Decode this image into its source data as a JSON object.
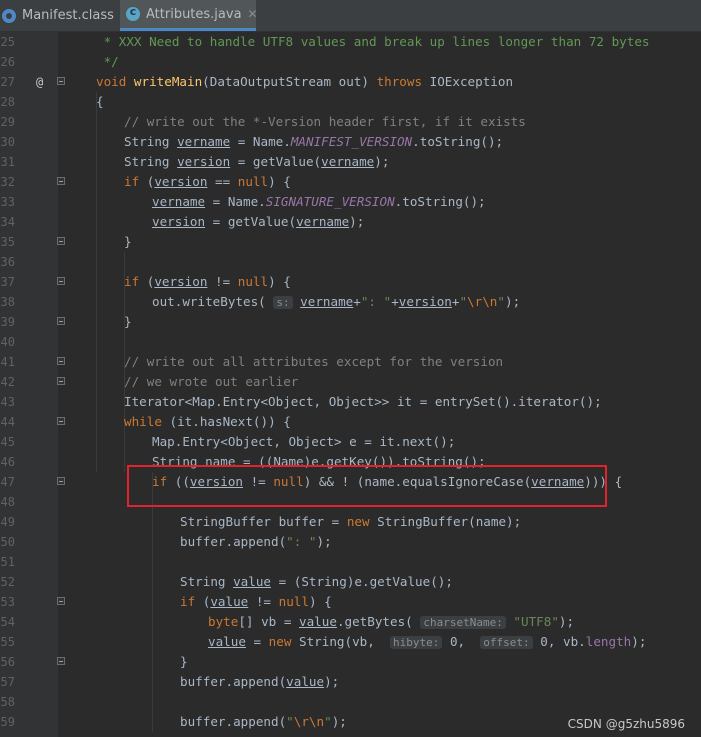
{
  "tabs": [
    {
      "label": "Manifest.class",
      "icon": "class-file-icon",
      "active": false
    },
    {
      "label": "Attributes.java",
      "icon": "java-class-icon",
      "active": true
    }
  ],
  "lines": [
    {
      "n": "25",
      "indent": 1,
      "tokens": [
        [
          "cm",
          " * XXX Need to handle UTF8 values and break up lines longer than 72 bytes"
        ]
      ]
    },
    {
      "n": "26",
      "indent": 1,
      "tokens": [
        [
          "cm",
          " */"
        ]
      ]
    },
    {
      "n": "27",
      "indent": 1,
      "mark": "@",
      "fold": true,
      "tokens": [
        [
          "kw",
          "void "
        ],
        [
          "fn",
          "writeMain"
        ],
        [
          "",
          "(DataOutputStream out) "
        ],
        [
          "kw",
          "throws "
        ],
        [
          "",
          "IOException"
        ]
      ]
    },
    {
      "n": "28",
      "indent": 1,
      "tokens": [
        [
          "",
          "{"
        ]
      ]
    },
    {
      "n": "29",
      "indent": 2,
      "tokens": [
        [
          "lc",
          "// write out the *-Version header first, if it exists"
        ]
      ]
    },
    {
      "n": "30",
      "indent": 2,
      "tokens": [
        [
          "",
          "String "
        ],
        [
          "ul",
          "vername"
        ],
        [
          "",
          " = Name."
        ],
        [
          "fld",
          "MANIFEST_VERSION"
        ],
        [
          "",
          ".toString();"
        ]
      ]
    },
    {
      "n": "31",
      "indent": 2,
      "tokens": [
        [
          "",
          "String "
        ],
        [
          "ul",
          "version"
        ],
        [
          "",
          " = getValue("
        ],
        [
          "ul",
          "vername"
        ],
        [
          "",
          ");"
        ]
      ]
    },
    {
      "n": "32",
      "indent": 2,
      "fold": true,
      "tokens": [
        [
          "kw",
          "if "
        ],
        [
          "",
          "("
        ],
        [
          "ul",
          "version"
        ],
        [
          "",
          " == "
        ],
        [
          "kw",
          "null"
        ],
        [
          "",
          ") {"
        ]
      ]
    },
    {
      "n": "33",
      "indent": 3,
      "tokens": [
        [
          "ul",
          "vername"
        ],
        [
          "",
          " = Name."
        ],
        [
          "fld",
          "SIGNATURE_VERSION"
        ],
        [
          "",
          ".toString();"
        ]
      ]
    },
    {
      "n": "34",
      "indent": 3,
      "tokens": [
        [
          "ul",
          "version"
        ],
        [
          "",
          " = getValue("
        ],
        [
          "ul",
          "vername"
        ],
        [
          "",
          ");"
        ]
      ]
    },
    {
      "n": "35",
      "indent": 2,
      "fold": true,
      "tokens": [
        [
          "",
          "}"
        ]
      ]
    },
    {
      "n": "36",
      "indent": 2,
      "tokens": []
    },
    {
      "n": "37",
      "indent": 2,
      "fold": true,
      "tokens": [
        [
          "kw",
          "if "
        ],
        [
          "",
          "("
        ],
        [
          "ul",
          "version"
        ],
        [
          "",
          " != "
        ],
        [
          "kw",
          "null"
        ],
        [
          "",
          ") {"
        ]
      ]
    },
    {
      "n": "38",
      "indent": 3,
      "tokens": [
        [
          "",
          "out.writeBytes( "
        ],
        [
          "hint",
          "s:"
        ],
        [
          "",
          " "
        ],
        [
          "ul",
          "vername"
        ],
        [
          "",
          "+"
        ],
        [
          "st",
          "\": \""
        ],
        [
          "",
          "+"
        ],
        [
          "ul",
          "version"
        ],
        [
          "",
          "+"
        ],
        [
          "st",
          "\""
        ],
        [
          "esc",
          "\\r\\n"
        ],
        [
          "st",
          "\""
        ],
        [
          "",
          ");"
        ]
      ]
    },
    {
      "n": "39",
      "indent": 2,
      "fold": true,
      "tokens": [
        [
          "",
          "}"
        ]
      ]
    },
    {
      "n": "40",
      "indent": 2,
      "tokens": []
    },
    {
      "n": "41",
      "indent": 2,
      "fold": true,
      "tokens": [
        [
          "lc",
          "// write out all attributes except for the version"
        ]
      ]
    },
    {
      "n": "42",
      "indent": 2,
      "fold": true,
      "tokens": [
        [
          "lc",
          "// we wrote out earlier"
        ]
      ]
    },
    {
      "n": "43",
      "indent": 2,
      "tokens": [
        [
          "",
          "Iterator<Map.Entry<Object, Object>> it = entrySet().iterator();"
        ]
      ]
    },
    {
      "n": "44",
      "indent": 2,
      "fold": true,
      "tokens": [
        [
          "kw",
          "while "
        ],
        [
          "",
          "(it.hasNext()) {"
        ]
      ]
    },
    {
      "n": "45",
      "indent": 3,
      "tokens": [
        [
          "",
          "Map.Entry<Object, Object> e = it.next();"
        ]
      ]
    },
    {
      "n": "46",
      "indent": 3,
      "tokens": [
        [
          "",
          "String name = ((Name)e.getKey()).toString();"
        ]
      ]
    },
    {
      "n": "47",
      "indent": 3,
      "fold": true,
      "tokens": [
        [
          "kw",
          "if "
        ],
        [
          "",
          "(("
        ],
        [
          "ul",
          "version"
        ],
        [
          "",
          " != "
        ],
        [
          "kw",
          "null"
        ],
        [
          "",
          ") && ! (name.equalsIgnoreCase("
        ],
        [
          "ul",
          "vername"
        ],
        [
          "",
          "))) {"
        ]
      ]
    },
    {
      "n": "48",
      "indent": 3,
      "tokens": []
    },
    {
      "n": "49",
      "indent": 4,
      "tokens": [
        [
          "",
          "StringBuffer buffer = "
        ],
        [
          "kw",
          "new "
        ],
        [
          "",
          "StringBuffer(name);"
        ]
      ]
    },
    {
      "n": "50",
      "indent": 4,
      "tokens": [
        [
          "",
          "buffer.append("
        ],
        [
          "st",
          "\": \""
        ],
        [
          "",
          ");"
        ]
      ]
    },
    {
      "n": "51",
      "indent": 4,
      "tokens": []
    },
    {
      "n": "52",
      "indent": 4,
      "tokens": [
        [
          "",
          "String "
        ],
        [
          "ul",
          "value"
        ],
        [
          "",
          " = (String)e.getValue();"
        ]
      ]
    },
    {
      "n": "53",
      "indent": 4,
      "fold": true,
      "tokens": [
        [
          "kw",
          "if "
        ],
        [
          "",
          "("
        ],
        [
          "ul",
          "value"
        ],
        [
          "",
          " != "
        ],
        [
          "kw",
          "null"
        ],
        [
          "",
          ") {"
        ]
      ]
    },
    {
      "n": "54",
      "indent": 5,
      "tokens": [
        [
          "kw",
          "byte"
        ],
        [
          "",
          "[] vb = "
        ],
        [
          "ul",
          "value"
        ],
        [
          "",
          ".getBytes( "
        ],
        [
          "hint",
          "charsetName:"
        ],
        [
          "",
          " "
        ],
        [
          "st",
          "\"UTF8\""
        ],
        [
          "",
          ");"
        ]
      ]
    },
    {
      "n": "55",
      "indent": 5,
      "tokens": [
        [
          "ul",
          "value"
        ],
        [
          "",
          " = "
        ],
        [
          "kw",
          "new "
        ],
        [
          "",
          "String(vb,  "
        ],
        [
          "hint",
          "hibyte:"
        ],
        [
          "",
          " 0,  "
        ],
        [
          "hint",
          "offset:"
        ],
        [
          "",
          " 0, vb."
        ],
        [
          "prop",
          "length"
        ],
        [
          "",
          ");"
        ]
      ]
    },
    {
      "n": "56",
      "indent": 4,
      "fold": true,
      "tokens": [
        [
          "",
          "}"
        ]
      ]
    },
    {
      "n": "57",
      "indent": 4,
      "tokens": [
        [
          "",
          "buffer.append("
        ],
        [
          "ul",
          "value"
        ],
        [
          "",
          ");"
        ]
      ]
    },
    {
      "n": "58",
      "indent": 4,
      "tokens": []
    },
    {
      "n": "59",
      "indent": 4,
      "tokens": [
        [
          "",
          "buffer.append("
        ],
        [
          "st",
          "\""
        ],
        [
          "esc",
          "\\r\\n"
        ],
        [
          "st",
          "\""
        ],
        [
          "",
          ");"
        ]
      ]
    }
  ],
  "watermark": "CSDN @g5zhu5896",
  "colors": {
    "background": "#2b2b2b",
    "keyword": "#cc7832",
    "string": "#6a8759",
    "highlight_box": "#e0232c"
  }
}
